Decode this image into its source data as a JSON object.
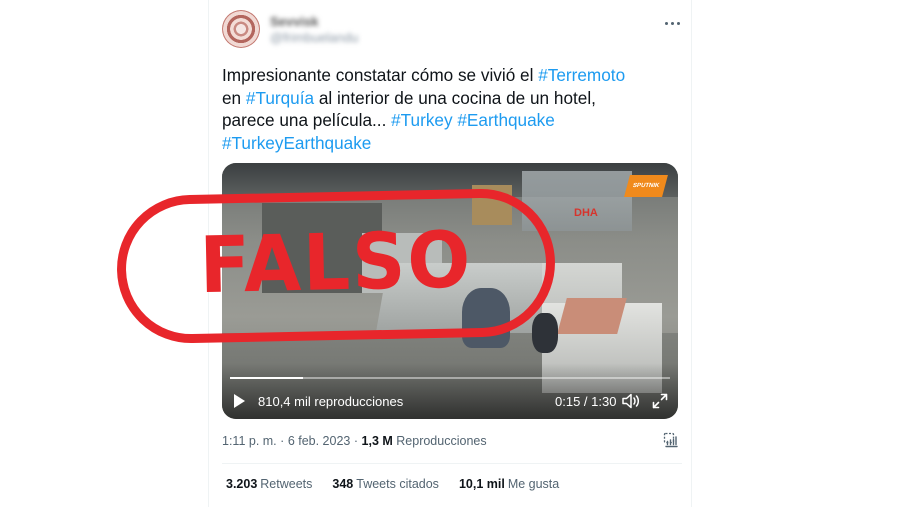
{
  "user": {
    "display_name": "Sevvisk",
    "handle": "@frimbuelandu"
  },
  "tweet": {
    "text_line1_plain": "Impresionante constatar cómo se vivió el ",
    "tag_terremoto": "#Terremoto",
    "text_line2_prefix": "en ",
    "tag_turquia": "#Turquía",
    "text_line2_plain": " al interior de una cocina de un hotel,",
    "text_line3_plain": "parece una película... ",
    "tag_turkey": "#Turkey",
    "tag_earthquake": "#Earthquake",
    "tag_turkeyearthquake": "#TurkeyEarthquake"
  },
  "video": {
    "views": "810,4 mil reproducciones",
    "time": "0:15 / 1:30",
    "progress": 0.167,
    "watermark_sputnik": "SPUTNIK",
    "watermark_dha": "DHA"
  },
  "meta": {
    "time": "1:11 p. m.",
    "separator": "·",
    "date": "6 feb. 2023",
    "separator2": "·",
    "views_count": "1,3 M",
    "views_label": "Reproducciones"
  },
  "stats": {
    "retweets_count": "3.203",
    "retweets_label": "Retweets",
    "quotes_count": "348",
    "quotes_label": "Tweets citados",
    "likes_count": "10,1 mil",
    "likes_label": "Me gusta"
  },
  "stamp": {
    "label": "FALSO",
    "color": "#e8262b"
  },
  "colors": {
    "link": "#1d9bf0",
    "text": "#0f1419",
    "secondary": "#536471"
  }
}
